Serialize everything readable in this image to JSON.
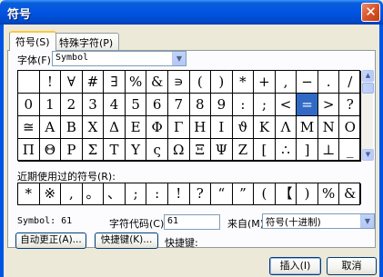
{
  "window": {
    "title": "符号",
    "close_glyph": "✕"
  },
  "tabs": [
    {
      "label": "符号(S)",
      "active": true
    },
    {
      "label": "特殊字符(P)",
      "active": false
    }
  ],
  "font": {
    "label": "字体(F):",
    "value": "Symbol"
  },
  "symbol_grid": {
    "rows": [
      [
        " ",
        "!",
        "∀",
        "#",
        "∃",
        "%",
        "&",
        "∍",
        "(",
        ")",
        "*",
        "+",
        ",",
        "−",
        ".",
        "/"
      ],
      [
        "0",
        "1",
        "2",
        "3",
        "4",
        "5",
        "6",
        "7",
        "8",
        "9",
        ":",
        ";",
        "<",
        "=",
        ">",
        "?"
      ],
      [
        "≅",
        "Α",
        "Β",
        "Χ",
        "Δ",
        "Ε",
        "Φ",
        "Γ",
        "Η",
        "Ι",
        "ϑ",
        "Κ",
        "Λ",
        "Μ",
        "Ν",
        "Ο"
      ],
      [
        "Π",
        "Θ",
        "Ρ",
        "Σ",
        "Τ",
        "Υ",
        "ς",
        "Ω",
        "Ξ",
        "Ψ",
        "Ζ",
        "[",
        "∴",
        "]",
        "⊥",
        "_"
      ]
    ],
    "selected": "="
  },
  "recent": {
    "label": "近期使用过的符号(R):",
    "symbols": [
      "*",
      "※",
      ",",
      "。",
      "、",
      ";",
      ":",
      "!",
      "?",
      "“",
      "”",
      "(",
      "【",
      ")",
      "%",
      "&"
    ]
  },
  "info": {
    "char_name": "Symbol: 61",
    "code_label": "字符代码(C):",
    "code_value": "61",
    "from_label": "来自(M):",
    "from_value": "符号(十进制)"
  },
  "buttons": {
    "autocorrect": "自动更正(A)...",
    "shortcut": "快捷键(K)...",
    "shortcut_label": "快捷键:",
    "insert": "插入(I)",
    "cancel": "取消"
  },
  "icons": {
    "scroll_up": "▲",
    "scroll_down": "▼",
    "dropdown": "▼"
  }
}
